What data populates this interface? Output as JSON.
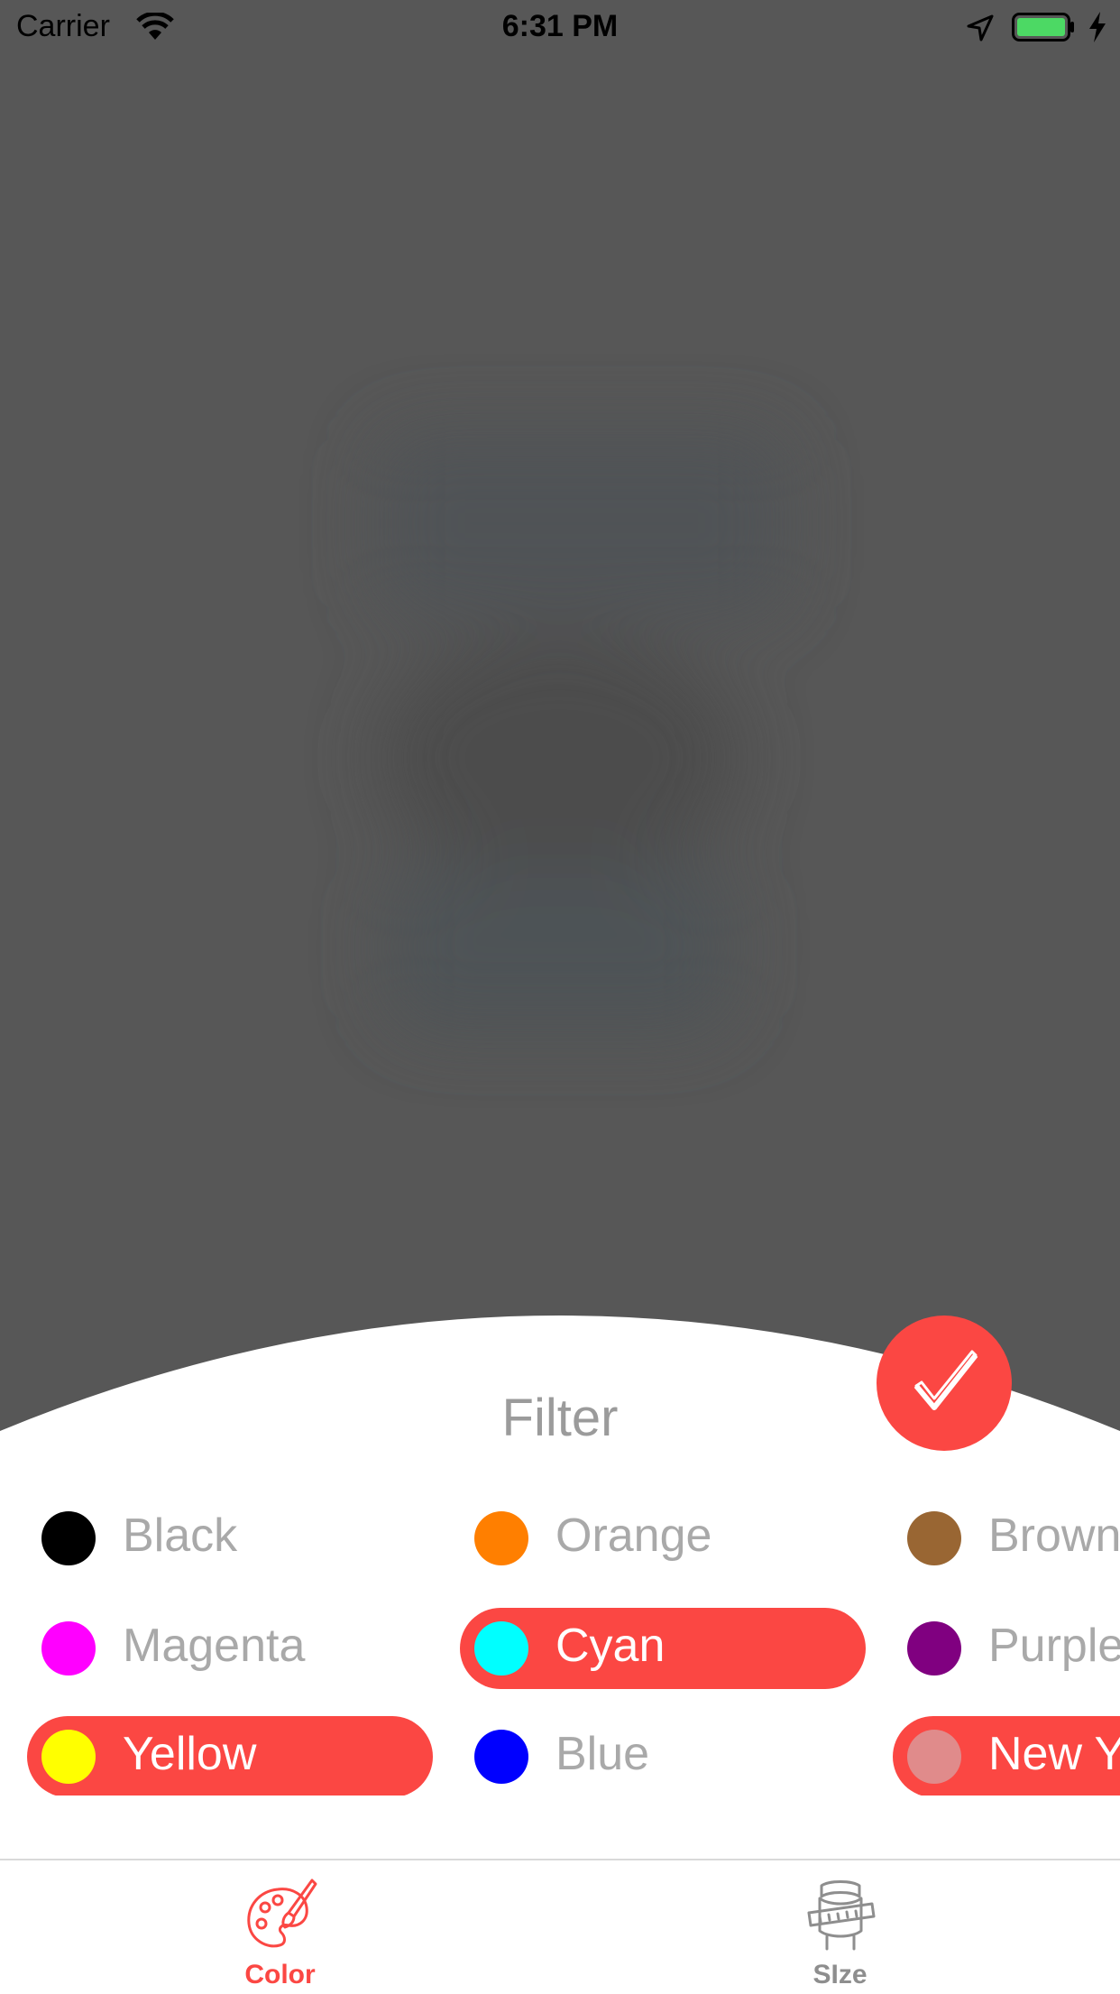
{
  "status_bar": {
    "carrier": "Carrier",
    "time": "6:31 PM",
    "battery_color": "#4cd964"
  },
  "sheet": {
    "title": "Filter",
    "confirm_icon": "checkmark-icon",
    "accent_color": "#fb4743"
  },
  "colors": [
    {
      "label": "Black",
      "swatch": "#000000",
      "selected": false
    },
    {
      "label": "Orange",
      "swatch": "#ff7f00",
      "selected": false
    },
    {
      "label": "Brown",
      "swatch": "#996633",
      "selected": false
    },
    {
      "label": "Magenta",
      "swatch": "#ff00ff",
      "selected": false
    },
    {
      "label": "Cyan",
      "swatch": "#00ffff",
      "selected": true
    },
    {
      "label": "Purple",
      "swatch": "#800080",
      "selected": false
    },
    {
      "label": "Yellow",
      "swatch": "#ffff00",
      "selected": true
    },
    {
      "label": "Blue",
      "swatch": "#0000ff",
      "selected": false
    },
    {
      "label": "New York",
      "swatch": "#e08b8b",
      "selected": true
    }
  ],
  "tabs": [
    {
      "label": "Color",
      "icon": "palette-icon",
      "active": true,
      "color": "#fb4743"
    },
    {
      "label": "SIze",
      "icon": "tape-measure-icon",
      "active": false,
      "color": "#8e8e8e"
    }
  ]
}
